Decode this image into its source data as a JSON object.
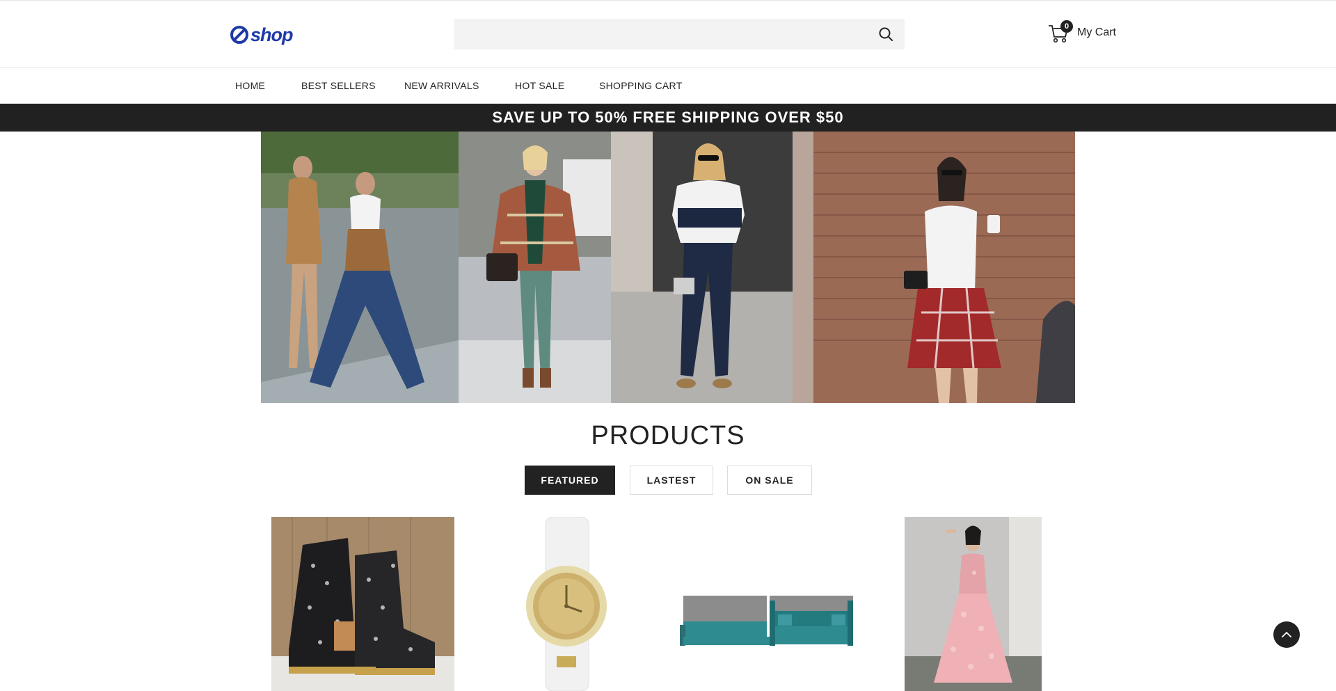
{
  "header": {
    "logo_text": "shop",
    "search": {
      "value": "",
      "placeholder": ""
    },
    "cart": {
      "count": "0",
      "label": "My Cart"
    }
  },
  "nav": {
    "items": [
      {
        "label": "HOME"
      },
      {
        "label": "BEST SELLERS"
      },
      {
        "label": "NEW ARRIVALS"
      },
      {
        "label": "HOT SALE"
      },
      {
        "label": "SHOPPING CART"
      }
    ]
  },
  "promo": {
    "text": "SAVE UP TO 50% FREE SHIPPING OVER $50"
  },
  "products": {
    "title": "PRODUCTS",
    "tabs": [
      {
        "label": "FEATURED"
      },
      {
        "label": "LASTEST"
      },
      {
        "label": "ON SALE"
      }
    ]
  },
  "colors": {
    "brand": "#1e3aa8",
    "dark": "#222222",
    "promo_bg": "#212121"
  }
}
